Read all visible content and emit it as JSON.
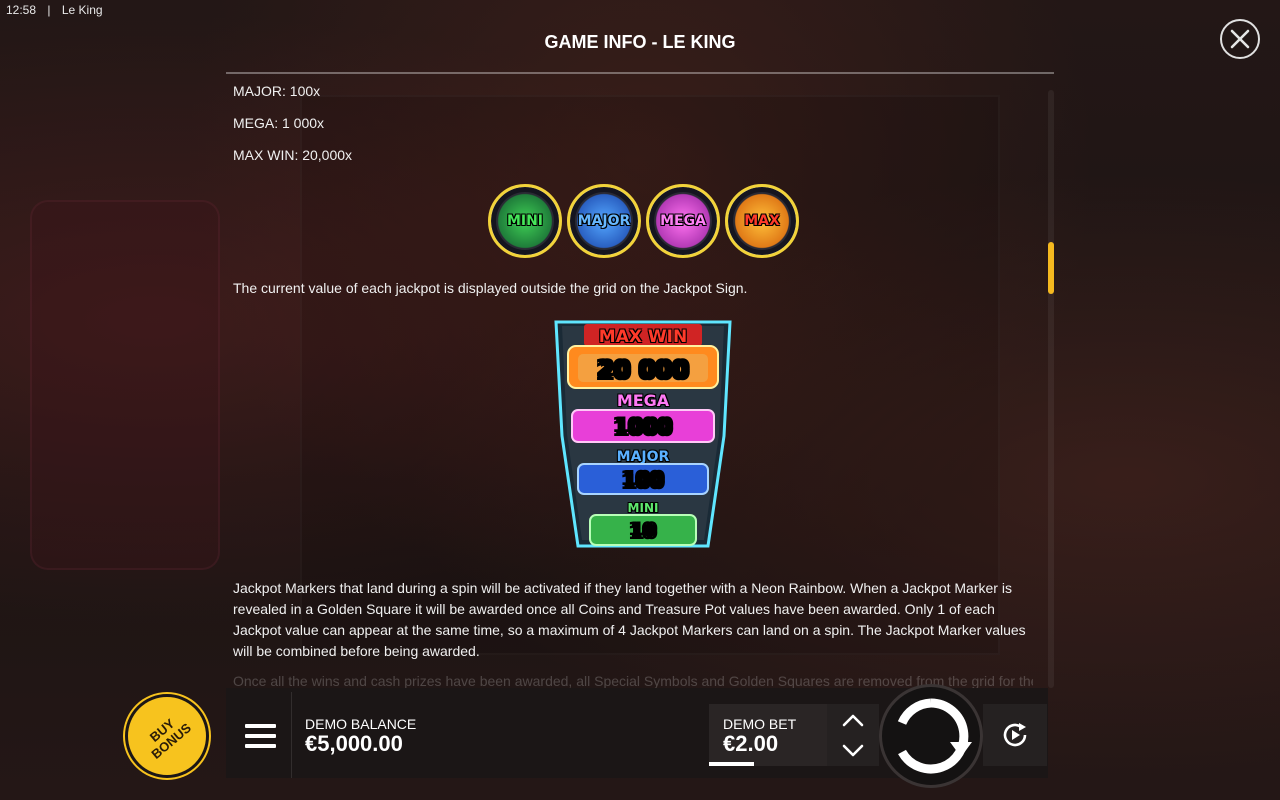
{
  "status_bar": {
    "time": "12:58",
    "app_name": "Le King"
  },
  "modal": {
    "title": "GAME INFO - LE KING",
    "close_icon": "close-icon"
  },
  "content": {
    "lines": [
      "MAJOR: 100x",
      "MEGA: 1 000x",
      "MAX WIN: 20,000x"
    ],
    "chips": [
      {
        "label": "MINI",
        "color": "#3fcf55"
      },
      {
        "label": "MAJOR",
        "color": "#54a7ff"
      },
      {
        "label": "MEGA",
        "color": "#ff72f0"
      },
      {
        "label": "MAX",
        "color": "#ffc03a"
      }
    ],
    "jackpot_sign_text": "The current value of each jackpot is displayed outside the grid on the Jackpot Sign.",
    "jackpot_sign": [
      {
        "label": "MAX WIN",
        "value": "20 000",
        "color": "#ff8a1e"
      },
      {
        "label": "MEGA",
        "value": "1000",
        "color": "#e83fd8"
      },
      {
        "label": "MAJOR",
        "value": "100",
        "color": "#3a7df0"
      },
      {
        "label": "MINI",
        "value": "10",
        "color": "#3fcf55"
      }
    ],
    "markers_paragraph": "Jackpot Markers that land during a spin will be activated if they land together with a Neon Rainbow. When a Jackpot Marker is revealed in a Golden Square it will be awarded once all Coins and Treasure Pot values have been awarded. Only 1 of each Jackpot value can appear at the same time, so a maximum of 4 Jackpot Markers can land on a spin. The Jackpot Marker values will be combined before being awarded.",
    "faded_line": "Once all the wins and cash prizes have been awarded, all Special Symbols and Golden Squares are removed from the grid for the"
  },
  "bottom_bar": {
    "buy_bonus_label": "BUY BONUS",
    "menu_icon": "hamburger-menu-icon",
    "balance_label": "DEMO BALANCE",
    "balance_value": "€5,000.00",
    "bet_label": "DEMO BET",
    "bet_value": "€2.00",
    "spin_icon": "spin-icon",
    "autoplay_icon": "autoplay-icon"
  },
  "colors": {
    "accent": "#f7c31e",
    "scroll_thumb": "#f5b91f",
    "background": "#1d1414"
  }
}
